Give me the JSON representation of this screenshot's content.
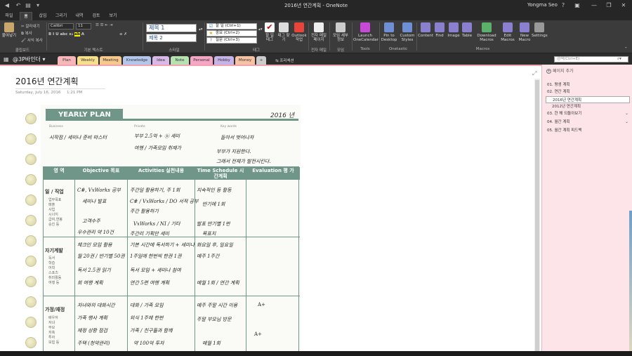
{
  "window": {
    "title": "2016년 연간계획 - OneNote",
    "user": "Yongma Seo"
  },
  "tabs": [
    "파일",
    "홈",
    "삽입",
    "그리기",
    "내역",
    "검토",
    "보기"
  ],
  "ribbon": {
    "clipboard": {
      "paste": "붙여넣기",
      "cut": "잘라내기",
      "copy": "복사",
      "format_painter": "서식 복사",
      "label": "클립보드"
    },
    "text": {
      "font": "Calibri",
      "size": "11",
      "label": "기본 텍스트"
    },
    "styles": {
      "heading1": "제목 1",
      "heading2": "제목 2",
      "label": "스타일"
    },
    "tags": {
      "items": [
        "할 일 (Ctrl+1)",
        "중요 (Ctrl+2)",
        "질문 (Ctrl+3)"
      ],
      "todo_tag": "할 일 태그",
      "find_tags": "태그 찾기",
      "outlook_tasks": "Outlook 작업",
      "label": "태그"
    },
    "email": {
      "email_page": "전자 메일 페이지",
      "label": "전자 메일"
    },
    "meeting": {
      "meeting_details": "모임 세부 정보",
      "label": "모임"
    },
    "tools": {
      "launch_calendar": "Launch OneCalendar",
      "label": "Tools"
    },
    "onetastic": {
      "pin_desktop": "Pin to Desktop",
      "custom_styles": "Custom Styles",
      "label": "Onetastic"
    },
    "macros": {
      "items": [
        "Content",
        "Find",
        "Image",
        "Table",
        "Download Macros",
        "Edit Macros",
        "New Macro",
        "Settings"
      ],
      "label": "Macros"
    }
  },
  "notebook": {
    "name": "@3P바인더",
    "sections": [
      "Plan",
      "Weekly",
      "Meeting",
      "Knowledge",
      "Idea",
      "Note",
      "Personal",
      "Hobby",
      "Money",
      "+"
    ],
    "extra": "프리섹션",
    "search_placeholder": "검색(Ctrl+E)"
  },
  "page": {
    "title": "2016년 연간계획",
    "date": "Saturday, July 16, 2016",
    "time": "1:21 PM"
  },
  "planner": {
    "banner": "YEARLY PLAN",
    "year": "2016 년",
    "labels": {
      "business": "Business",
      "private": "Private",
      "keywords": "Key words"
    },
    "notes": [
      "시작점 / 세미나 준비 마스터",
      "부부 2.5억 + ⓑ 세미",
      "여행 / 가족모임 취재가",
      "돌아서 벗어나자",
      "부부가 지원한다.",
      "그래서 전체가 발전시킨다."
    ],
    "headers": [
      "영 역",
      "Objective 목표",
      "Activities 실천내용",
      "Time Schedule 시간계획",
      "Evaluation 평 가"
    ],
    "rows": [
      {
        "area": "일 / 직업",
        "sub": [
          "업무목표",
          "매출",
          "사업",
          "시너지",
          "급여,연봉",
          "승진 등"
        ],
        "objective": [
          "C#, VxWorks 공부",
          "세미나 발표",
          "고객수주",
          "우수관리 약 10건"
        ],
        "activities": [
          "주간일 활용하기, 주 1회",
          "C# / VxWorks / DO 서적 공부",
          "주간 활용하기",
          "VxWorks / NI / 기타",
          "주간리 기획안 세미"
        ],
        "time": [
          "지속적인 등 활동",
          "반기에 1회",
          "발표 반기별 1번",
          "목표치"
        ],
        "evaluation": []
      },
      {
        "area": "자기계발",
        "sub": [
          "독서",
          "학습",
          "어학",
          "스포츠",
          "취미활동",
          "여행 등"
        ],
        "objective": [
          "체크인 모임 활용",
          "월 20권 / 반기별 50권",
          "독서 2.5권 읽기",
          "회 여행 계획"
        ],
        "activities": [
          "기본 시간에 독서하기 + 세미나",
          "1주일에 한번씩 한권 1권",
          "독서 모임 + 세미나 참여",
          "연간 5편 여행 계획"
        ],
        "time": [
          "화요일 후, 일요일",
          "매주 1주간",
          "매월 1회 / 연간 계획"
        ],
        "evaluation": []
      },
      {
        "area": "가정/재정",
        "sub": [
          "배우자",
          "자녀",
          "부모",
          "저축",
          "투자",
          "보험 등"
        ],
        "objective": [
          "자녀와의 대화시간",
          "가족 행사 계획",
          "재정 상황 점검",
          "주택 (청약관리)"
        ],
        "activities": [
          "대화 / 가족 모임",
          "외식 1주에 한번",
          "가족 / 친구들과 함께",
          "약 100억 투자"
        ],
        "time": [
          "매주 주말 시간 이용",
          "주말 부모님 방문",
          "매월 1회"
        ],
        "evaluation": [
          "A+",
          "A+"
        ]
      }
    ]
  },
  "pages_pane": {
    "add_page": "페이지 추가",
    "items": [
      {
        "label": "01. 평생 계획",
        "level": 0
      },
      {
        "label": "02. 연간 계획",
        "level": 0
      },
      {
        "label": "2016년 연간계획",
        "level": 1,
        "selected": true
      },
      {
        "label": "2012년 연간계획",
        "level": 1
      },
      {
        "label": "03. 한 해 되돌아보기",
        "level": 0,
        "collapsible": true
      },
      {
        "label": "04. 월간 계획",
        "level": 0,
        "collapsible": true
      },
      {
        "label": "05. 월간 계획 피드백",
        "level": 0
      }
    ]
  },
  "colors": {
    "section_tabs": [
      "#f7b7b9",
      "#f7e08c",
      "#f7c98c",
      "#b3c7ec",
      "#d7b8e6",
      "#b6e2b0",
      "#f4a6c4",
      "#c6b3e8",
      "#f5c2a3",
      "#cccccc"
    ],
    "accent_pink": "#f2a3b0",
    "planner_green": "#6f9688"
  },
  "icons": [
    "back-icon",
    "undo-icon",
    "dropdown-icon",
    "search-icon"
  ]
}
